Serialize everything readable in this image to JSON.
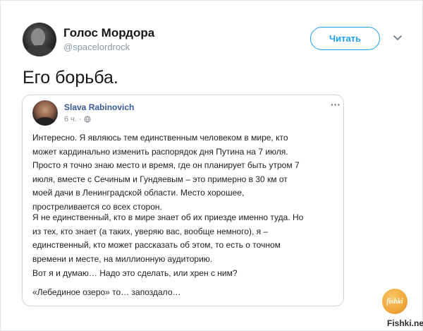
{
  "tweet": {
    "author_name": "Голос Мордора",
    "author_handle": "@spacelordrock",
    "follow_label": "Читать",
    "text": "Его борьба."
  },
  "quote": {
    "author_name": "Slava Rabinovich",
    "time": "6 ч. ·",
    "more": "···",
    "paragraphs": [
      {
        "lines": [
          "Интересно. Я являюсь тем единственным человеком в мире, кто",
          "может кардинально изменить распорядок дня Путина на 7 июля.",
          "Просто я точно знаю место и время, где он планирует быть утром 7",
          "июля, вместе с Сечиным и Гундяевым – это примерно в 30 км от",
          "моей дачи в Ленинградской области. Место хорошее,",
          "простреливается со всех сторон."
        ]
      },
      {
        "lines": [
          "Я не единственный, кто в мире знает об их приезде именно туда. Но",
          "из тех, кто знает (а таких, уверяю вас, вообще немного), я –",
          "единственный, кто может рассказать об этом, то есть о точном",
          "времени и месте, на миллионную аудиторию."
        ]
      },
      {
        "lines": [
          "Вот я и думаю… Надо это сделать, или хрен с ним?"
        ]
      },
      {
        "lines": [
          "«Лебединое озеро» то… запоздало…"
        ]
      }
    ]
  },
  "watermark": {
    "logo_text": "fishki",
    "site": "Fishki.net"
  },
  "colors": {
    "accent": "#1da1f2",
    "fb_name": "#385898",
    "border": "#ccd6dd",
    "muted": "#8899a6"
  }
}
